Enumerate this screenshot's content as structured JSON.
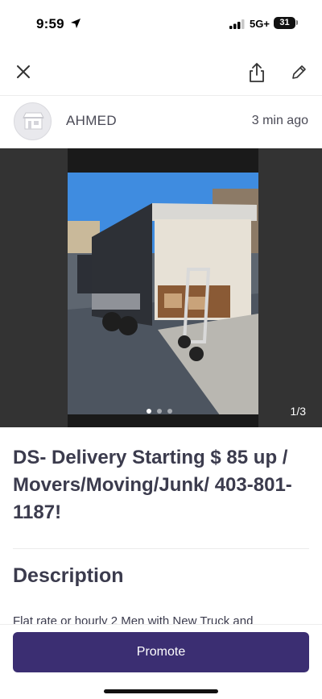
{
  "status_bar": {
    "time": "9:59",
    "network": "5G+",
    "battery": "31"
  },
  "toolbar": {
    "close_icon": "close-icon",
    "share_icon": "share-icon",
    "edit_icon": "edit-pencil-icon"
  },
  "seller": {
    "name": "AHMED",
    "posted": "3 min ago",
    "avatar_icon": "storefront-icon"
  },
  "gallery": {
    "counter": "1/3",
    "total_images": 3,
    "active_index": 1
  },
  "listing": {
    "title": "DS- Delivery Starting $ 85 up / Movers/Moving/Junk/ 403-801-1187!",
    "description_heading": "Description",
    "description_preview": "Flat rate or hourly 2 Men with New Truck and"
  },
  "actions": {
    "promote_label": "Promote"
  },
  "colors": {
    "primary": "#3b2e72",
    "text": "#3b3b4d",
    "gallery_bg": "#333333"
  }
}
